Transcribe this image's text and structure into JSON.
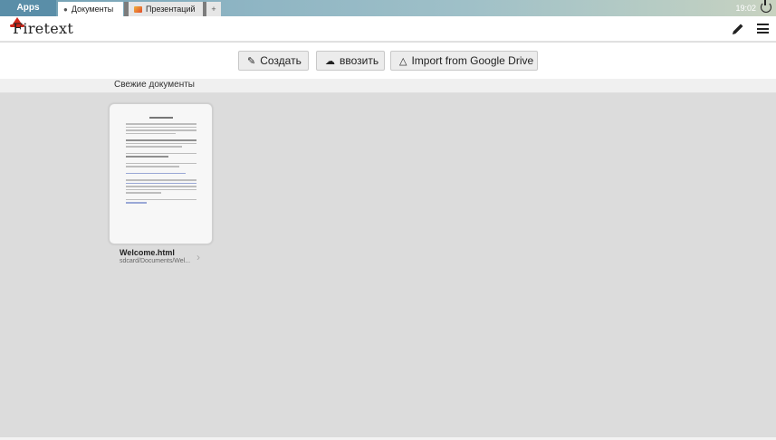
{
  "system": {
    "apps_label": "Apps",
    "clock": "19:02",
    "power_icon": "power-icon"
  },
  "tabs": [
    {
      "label": "Документы",
      "icon": "flame-icon",
      "active": true
    },
    {
      "label": "Презентаций",
      "icon": "slides-icon",
      "active": false
    }
  ],
  "new_tab_label": "+",
  "header": {
    "logo_text": "Firetext",
    "edit_icon": "pencil-icon",
    "menu_icon": "menu-icon"
  },
  "actions": {
    "create_label": "Создать",
    "import_label": "ввозить",
    "drive_label": "Import from Google Drive"
  },
  "recent": {
    "title": "Свежие документы",
    "documents": [
      {
        "name": "Welcome.html",
        "path": "sdcard/Documents/Wel..."
      }
    ]
  },
  "colors": {
    "accent_red": "#d1261a",
    "tabbar": "#8db4c3"
  }
}
